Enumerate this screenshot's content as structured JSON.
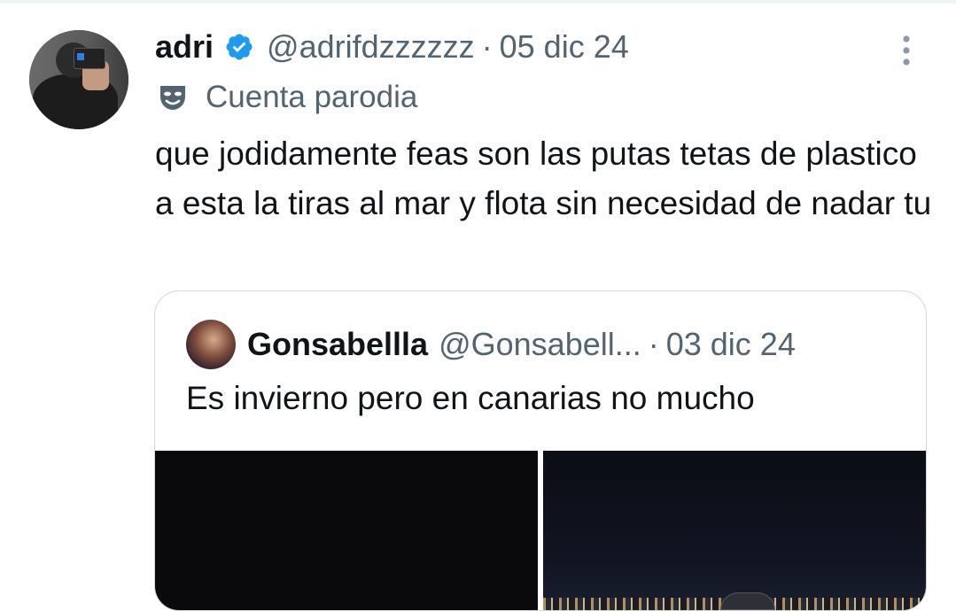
{
  "tweet": {
    "author_name": "adri",
    "handle": "@adrifdzzzzzz",
    "separator": "·",
    "date": "05 dic 24",
    "label": "Cuenta parodia",
    "text": "que jodidamente feas son las putas tetas de plastico a esta la tiras al mar y flota sin necesidad de nadar tu",
    "icons": {
      "verified": "verified-badge-icon",
      "more": "more-vertical-icon",
      "parody": "theater-masks-icon"
    }
  },
  "quoted_tweet": {
    "author_name": "Gonsabellla",
    "handle": "@Gonsabell...",
    "separator": "·",
    "date": "03 dic 24",
    "text": "Es invierno pero en canarias no mucho"
  },
  "colors": {
    "text_primary": "#0f1419",
    "text_secondary": "#536471",
    "verified_blue": "#1d9bf0",
    "border": "#cfd9de"
  }
}
